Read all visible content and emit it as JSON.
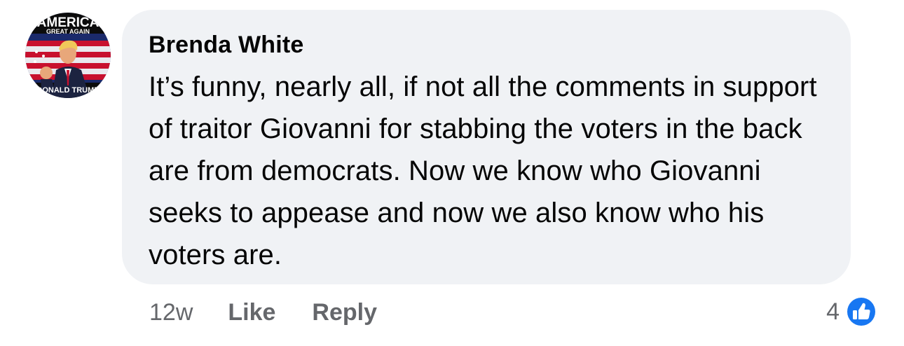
{
  "comment": {
    "author": "Brenda White",
    "text": "It’s funny, nearly all, if not all the comments in support of traitor Giovanni for stabbing the voters in the back are from democrats. Now we know who Giovanni seeks to appease and now we also know who his voters are.",
    "avatar_banner_top": "AMERICA",
    "avatar_banner_sub": "GREAT AGAIN",
    "avatar_banner_bottom": "DONALD TRUMP"
  },
  "actions": {
    "timestamp": "12w",
    "like_label": "Like",
    "reply_label": "Reply"
  },
  "reactions": {
    "count": "4",
    "icon": "thumbs-up-icon",
    "color": "#1877f2"
  },
  "colors": {
    "bubble_background": "#f0f2f5",
    "text": "#050505",
    "secondary_text": "#65676b"
  }
}
